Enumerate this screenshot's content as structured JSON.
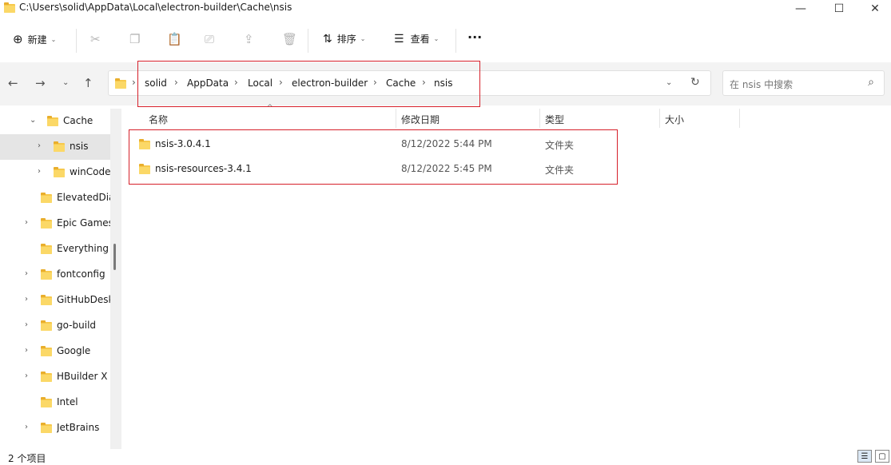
{
  "window": {
    "title": "C:\\Users\\solid\\AppData\\Local\\electron-builder\\Cache\\nsis",
    "minimize": "—",
    "maximize": "☐",
    "close": "✕"
  },
  "toolbar": {
    "new_label": "新建",
    "sort_label": "排序",
    "view_label": "查看",
    "more_label": "···"
  },
  "address": {
    "crumbs": [
      "solid",
      "AppData",
      "Local",
      "electron-builder",
      "Cache",
      "nsis"
    ]
  },
  "search": {
    "placeholder": "在 nsis 中搜索"
  },
  "sidebar": {
    "items": [
      {
        "label": "Cache",
        "expanded": true
      },
      {
        "label": "nsis",
        "selected": true
      },
      {
        "label": "winCodeSign"
      },
      {
        "label": "ElevatedDiagnostics"
      },
      {
        "label": "Epic Games"
      },
      {
        "label": "Everything"
      },
      {
        "label": "fontconfig"
      },
      {
        "label": "GitHubDesktop"
      },
      {
        "label": "go-build"
      },
      {
        "label": "Google"
      },
      {
        "label": "HBuilder X"
      },
      {
        "label": "Intel"
      },
      {
        "label": "JetBrains"
      }
    ]
  },
  "columns": [
    "名称",
    "修改日期",
    "类型",
    "大小"
  ],
  "files": [
    {
      "name": "nsis-3.0.4.1",
      "modified": "8/12/2022 5:44 PM",
      "type": "文件夹"
    },
    {
      "name": "nsis-resources-3.4.1",
      "modified": "8/12/2022 5:45 PM",
      "type": "文件夹"
    }
  ],
  "status": {
    "count": "2 个项目"
  },
  "colors": {
    "highlight_box": "#d6202a",
    "folder": "#f7c94c"
  }
}
